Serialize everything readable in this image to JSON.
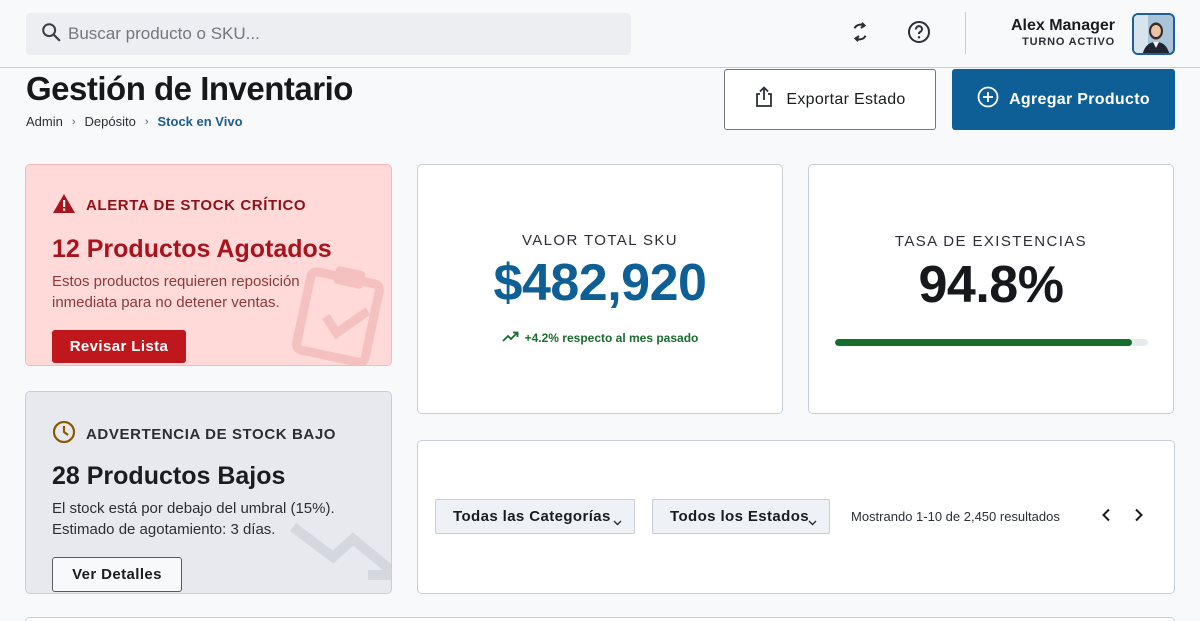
{
  "search": {
    "placeholder": "Buscar producto o SKU..."
  },
  "icons": {
    "search": "search-icon",
    "sync": "sync-icon",
    "help": "help-icon",
    "upload": "upload-icon",
    "add": "add-circle-icon",
    "warning": "warning-icon",
    "clock": "clock-icon",
    "trend": "trending-up-icon",
    "chevron_left": "chevron-left-icon",
    "chevron_right": "chevron-right-icon"
  },
  "user": {
    "name": "Alex Manager",
    "status": "TURNO ACTIVO"
  },
  "header": {
    "title": "Gestión de Inventario",
    "breadcrumb": [
      "Admin",
      "Depósito",
      "Stock en Vivo"
    ],
    "export_label": "Exportar Estado",
    "add_label": "Agregar Producto"
  },
  "alerts": {
    "critical": {
      "heading": "ALERTA DE STOCK CRÍTICO",
      "title": "12 Productos Agotados",
      "description": "Estos productos requieren reposición inmediata para no detener ventas.",
      "button": "Revisar Lista"
    },
    "low": {
      "heading": "ADVERTENCIA DE STOCK BAJO",
      "title": "28 Productos Bajos",
      "description": "El stock está por debajo del umbral (15%). Estimado de agotamiento: 3 días.",
      "button": "Ver Detalles"
    }
  },
  "stats": {
    "sku_total": {
      "label": "VALOR TOTAL SKU",
      "value": "$482,920",
      "trend": "+4.2% respecto al mes pasado"
    },
    "stock_rate": {
      "label": "TASA DE EXISTENCIAS",
      "value": "94.8%",
      "progress": 0.948
    }
  },
  "filters": {
    "category": "Todas las Categorías",
    "status": "Todos los Estados",
    "results": "Mostrando 1-10 de 2,450 resultados"
  },
  "colors": {
    "primary": "#0e5f96",
    "critical_bg": "#ffdad8",
    "critical_text": "#a8141e",
    "critical_button": "#c0171d",
    "success": "#156e2c",
    "low_bg": "#e7e9ef"
  }
}
